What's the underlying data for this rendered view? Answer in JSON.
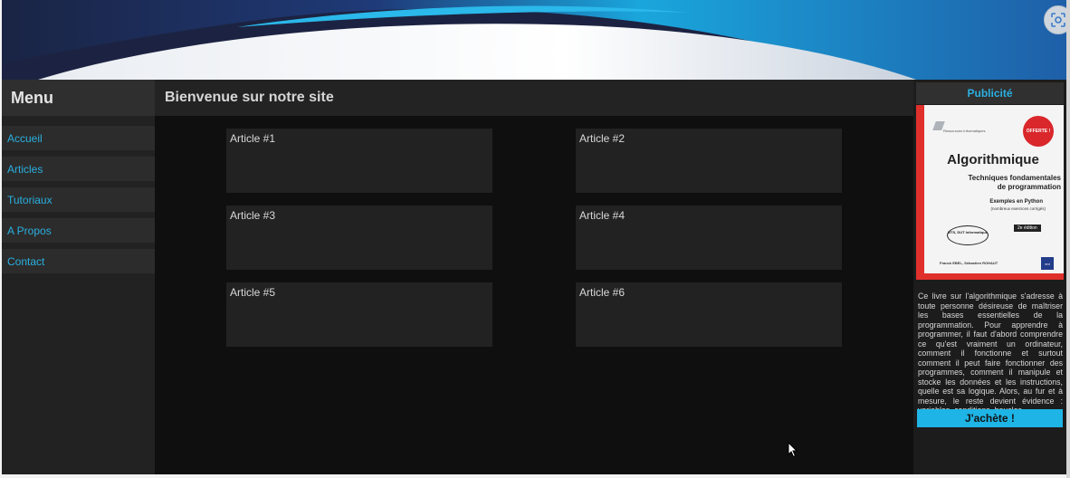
{
  "ui": {
    "lens_icon": "lens-scan-icon",
    "cursor_icon": "mouse-pointer-icon"
  },
  "sidebar": {
    "title": "Menu",
    "items": [
      {
        "label": "Accueil"
      },
      {
        "label": "Articles"
      },
      {
        "label": "Tutoriaux"
      },
      {
        "label": "A Propos"
      },
      {
        "label": "Contact"
      }
    ]
  },
  "main": {
    "title": "Bienvenue sur notre site",
    "articles": [
      {
        "label": "Article #1"
      },
      {
        "label": "Article #2"
      },
      {
        "label": "Article #3"
      },
      {
        "label": "Article #4"
      },
      {
        "label": "Article #5"
      },
      {
        "label": "Article #6"
      }
    ]
  },
  "ad": {
    "title": "Publicité",
    "book": {
      "publisher_line": "Ressources Informatiques",
      "badge": "OFFERTE !",
      "title": "Algorithmique",
      "subtitle1": "Techniques fondamentales",
      "subtitle2": "de programmation",
      "examples": "Exemples en Python",
      "note": "(nombreux exercices corrigés)",
      "edition": "2e édition",
      "bts": "BTS, DUT Informatique",
      "authors": "Franck EBEL, Sébastien ROHAUT",
      "eni": "eni"
    },
    "description": "Ce livre sur l'algorithmique s'adresse à toute personne désireuse de maîtriser les bases essentielles de la programmation. Pour apprendre à programmer, il faut d'abord comprendre ce qu'est vraiment un ordinateur, comment il fonctionne et surtout comment il peut faire fonctionner des programmes, comment il manipule et stocke les données et les instructions, quelle est sa logique. Alors, au fur et à mesure, le reste devient évidence : variables, conditions, boucles...",
    "button_label": "J'achète !"
  },
  "colors": {
    "accent": "#1eb4e6",
    "link": "#2ab0e0",
    "background_main": "#0f0f0f",
    "panel": "#222222",
    "header_banner": "#1b2240"
  }
}
